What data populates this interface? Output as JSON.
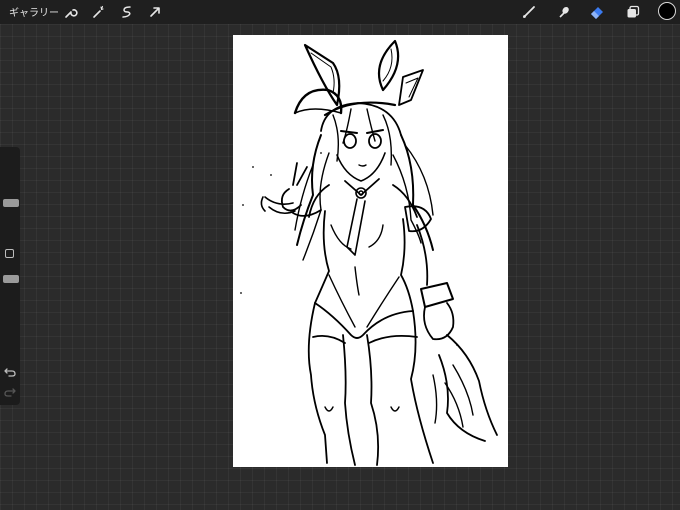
{
  "topbar": {
    "gallery_label": "ギャラリー",
    "left_tools": [
      "wrench-icon",
      "magic-wand-icon",
      "selection-icon",
      "transform-arrow-icon"
    ],
    "right_tools": [
      "brush-icon",
      "smudge-icon",
      "eraser-icon",
      "layers-icon"
    ],
    "active_tool": "eraser",
    "accent_color": "#3b7bf0",
    "current_color": "#000000"
  },
  "sidebar": {
    "brush_size": 0.15,
    "opacity": 0.15,
    "buttons": [
      "modify-square-icon",
      "undo-icon",
      "redo-icon"
    ]
  },
  "canvas": {
    "background": "#ffffff",
    "content": "bunny-girl-line-sketch"
  }
}
